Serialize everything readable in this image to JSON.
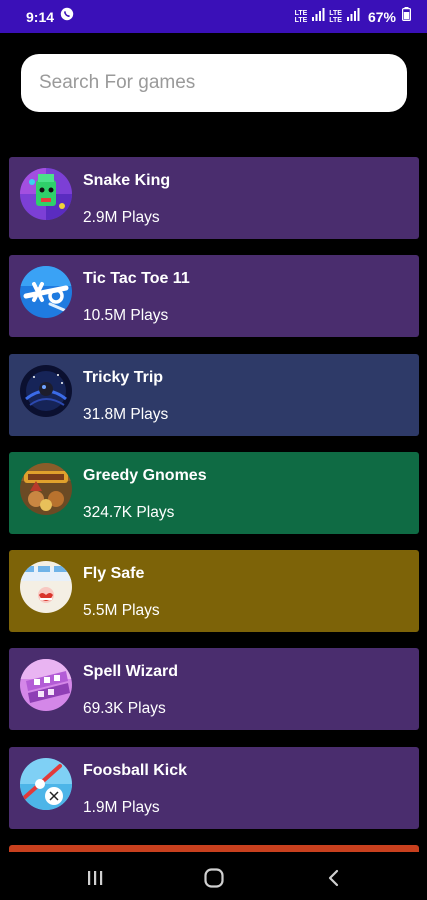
{
  "status_bar": {
    "time": "9:14",
    "lte_top": "LTE",
    "lte_bottom": "LTE",
    "lte2_top": "LTE",
    "lte2_bottom": "LTE",
    "battery": "67%",
    "background": "#3a10b8",
    "icons": [
      "whatsapp-icon",
      "signal-icon",
      "signal-icon",
      "battery-icon"
    ]
  },
  "search": {
    "placeholder": "Search For games",
    "value": ""
  },
  "games": [
    {
      "title": "Snake King",
      "plays": "2.9M Plays",
      "color": "#4a2d6e",
      "icon": "snake-king-icon"
    },
    {
      "title": "Tic Tac Toe 11",
      "plays": "10.5M Plays",
      "color": "#4a2d6e",
      "icon": "tic-tac-toe-icon"
    },
    {
      "title": "Tricky Trip",
      "plays": "31.8M Plays",
      "color": "#2e3a68",
      "icon": "tricky-trip-icon"
    },
    {
      "title": "Greedy Gnomes",
      "plays": "324.7K Plays",
      "color": "#0f6b44",
      "icon": "greedy-gnomes-icon"
    },
    {
      "title": "Fly Safe",
      "plays": "5.5M Plays",
      "color": "#7d6308",
      "icon": "fly-safe-icon"
    },
    {
      "title": "Spell Wizard",
      "plays": "69.3K Plays",
      "color": "#4a2d6e",
      "icon": "spell-wizard-icon"
    },
    {
      "title": "Foosball Kick",
      "plays": "1.9M Plays",
      "color": "#4a2d6e",
      "icon": "foosball-kick-icon"
    }
  ],
  "partial_card_color": "#c8401e",
  "nav_bar": {
    "icons": [
      "recent-apps-icon",
      "home-icon",
      "back-icon"
    ]
  }
}
